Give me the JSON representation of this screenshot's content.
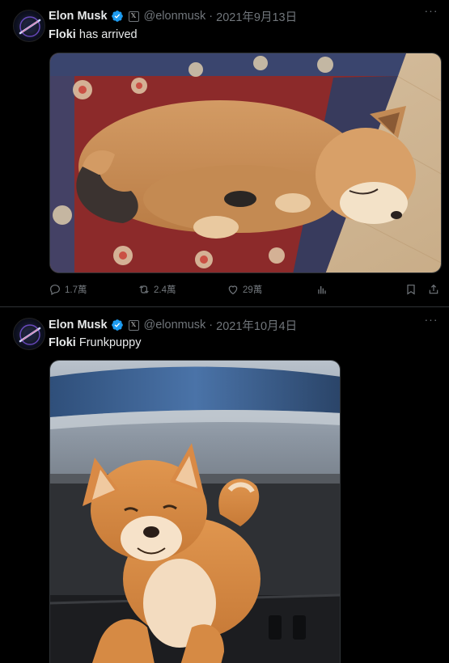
{
  "tweets": [
    {
      "author": {
        "name": "Elon Musk",
        "handle": "@elonmusk"
      },
      "separator": "·",
      "date": "2021年9月13日",
      "text_bold": "Floki",
      "text_rest": "has arrived",
      "media": {
        "description": "sleeping shiba inu puppy on a rug"
      },
      "actions": {
        "replies": "1.7萬",
        "reposts": "2.4萬",
        "likes": "29萬"
      }
    },
    {
      "author": {
        "name": "Elon Musk",
        "handle": "@elonmusk"
      },
      "separator": "·",
      "date": "2021年10月4日",
      "text_bold": "Floki",
      "text_rest": "Frunkpuppy",
      "media": {
        "description": "shiba inu puppy sitting in a car frunk"
      }
    }
  ],
  "icons": {
    "verified": "verified-badge-icon",
    "affiliate": "x-affiliate-icon",
    "more": "more-icon",
    "reply": "reply-icon",
    "repost": "repost-icon",
    "like": "heart-icon",
    "views": "views-icon",
    "bookmark": "bookmark-icon",
    "share": "share-icon"
  },
  "colors": {
    "background": "#000000",
    "text": "#e7e9ea",
    "secondary": "#71767b",
    "verified": "#1d9bf0",
    "divider": "#2f3336"
  }
}
